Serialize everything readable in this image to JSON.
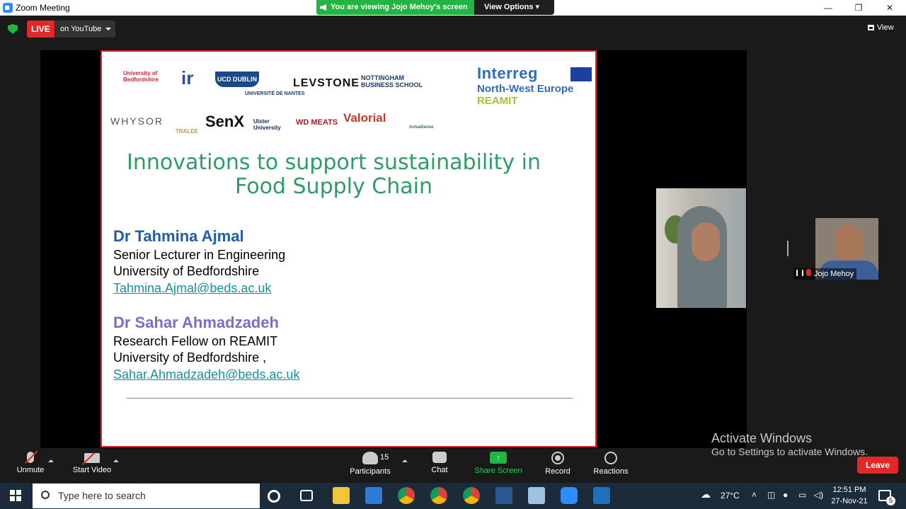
{
  "window": {
    "title": "Zoom Meeting",
    "minimize": "—",
    "restore": "❐",
    "close": "✕"
  },
  "banner": {
    "viewing_text": "You are viewing Jojo Mehoy's screen",
    "view_options": "View Options"
  },
  "topbar": {
    "live_label": "LIVE",
    "stream_target": "on YouTube",
    "view_label": "View"
  },
  "slide": {
    "logos": [
      "University of Bedfordshire",
      "ir",
      "UCD DUBLIN",
      "UNIVERSITÉ DE NANTES",
      "LEVSTONE",
      "NOTTINGHAM BUSINESS SCHOOL",
      "WHYSOR",
      "TRALEE",
      "SenX",
      "Ulster University",
      "WD MEATS",
      "Valorial",
      "ActuaSense"
    ],
    "interreg": {
      "line1": "Interreg",
      "line2": "North-West Europe",
      "line3": "REAMIT"
    },
    "title_line1": "Innovations to support sustainability in",
    "title_line2": "Food Supply Chain",
    "author1": {
      "name": "Dr Tahmina Ajmal",
      "role": "Senior Lecturer in Engineering",
      "org": "University of Bedfordshire",
      "email": "Tahmina.Ajmal@beds.ac.uk"
    },
    "author2": {
      "name": "Dr Sahar Ahmadzadeh",
      "role": "Research Fellow on REAMIT",
      "org": "University of Bedfordshire ,",
      "email": "Sahar.Ahmadzadeh@beds.ac.uk"
    }
  },
  "participant_tile": {
    "name": "Jojo Mehoy"
  },
  "watermark": {
    "line1": "Activate Windows",
    "line2": "Go to Settings to activate Windows."
  },
  "toolbar": {
    "unmute": "Unmute",
    "start_video": "Start Video",
    "participants": "Participants",
    "participants_count": "15",
    "chat": "Chat",
    "share_screen": "Share Screen",
    "record": "Record",
    "reactions": "Reactions",
    "leave": "Leave"
  },
  "taskbar": {
    "search_placeholder": "Type here to search",
    "weather": "27°C",
    "time": "12:51 PM",
    "date": "27-Nov-21",
    "notification_count": "5"
  }
}
